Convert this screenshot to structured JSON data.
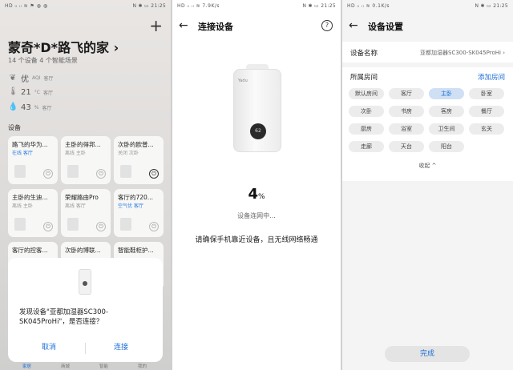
{
  "p1": {
    "status_left": "HD ᵢₗ ᵢₗ ≋ ⚑ ◍ ◍",
    "status_right": "N ✱ ▭ 21:25",
    "title": "蒙奇*D*路飞的家",
    "subtitle": "14 个设备  4 个智能场景",
    "air": {
      "value": "优",
      "unit": "AQI",
      "room": "客厅"
    },
    "temp": {
      "value": "21",
      "unit": "°C",
      "room": "客厅"
    },
    "humidity": {
      "value": "43",
      "unit": "%",
      "room": "客厅"
    },
    "section_label": "设备",
    "cards": [
      {
        "name": "路飞的华为...",
        "status": "在线 客厅",
        "online": true
      },
      {
        "name": "主卧的得邦...",
        "status": "离线 主卧",
        "online": false
      },
      {
        "name": "次卧的欧普...",
        "status": "关闭 次卧",
        "online": false,
        "power_on": true
      },
      {
        "name": "主卧的生迪...",
        "status": "离线 主卧",
        "online": false
      },
      {
        "name": "荣耀路由Pro",
        "status": "离线 客厅",
        "online": false
      },
      {
        "name": "客厅的720...",
        "status": "空气优 客厅",
        "online": true
      },
      {
        "name": "客厅的控客...",
        "status": "",
        "online": false
      },
      {
        "name": "次卧的博联...",
        "status": "",
        "online": false
      },
      {
        "name": "智能鞋柜护...",
        "status": "",
        "online": false
      }
    ],
    "dialog": {
      "message": "发现设备\"亚都加湿器SC300-SK045ProHi\"，是否连接？",
      "cancel": "取消",
      "connect": "连接"
    },
    "tabs": [
      "家居",
      "商城",
      "智能",
      "我的"
    ]
  },
  "p2": {
    "status_left": "HD ᵢₗ ᵢₗ ≋ 7.9K/s",
    "status_right": "N ✱ ▭ 21:25",
    "title": "连接设备",
    "brand": "Yadu",
    "display": "62",
    "percent": "4",
    "percent_unit": "%",
    "connecting": "设备连网中...",
    "tip": "请确保手机靠近设备，且无线网络畅通"
  },
  "p3": {
    "status_left": "HD ᵢₗ ᵢₗ ≋ 0.1K/s",
    "status_right": "N ✱ ▭ 21:25",
    "title": "设备设置",
    "name_label": "设备名称",
    "name_value": "亚都加湿器SC300-SK045ProHi",
    "room_label": "所属房间",
    "add_room": "添加房间",
    "rooms": [
      "默认房间",
      "客厅",
      "主卧",
      "卧室",
      "次卧",
      "书房",
      "客房",
      "餐厅",
      "厨房",
      "浴室",
      "卫生间",
      "玄关",
      "走廊",
      "天台",
      "阳台"
    ],
    "selected_room": "主卧",
    "collapse": "收起 ^",
    "done": "完成"
  }
}
